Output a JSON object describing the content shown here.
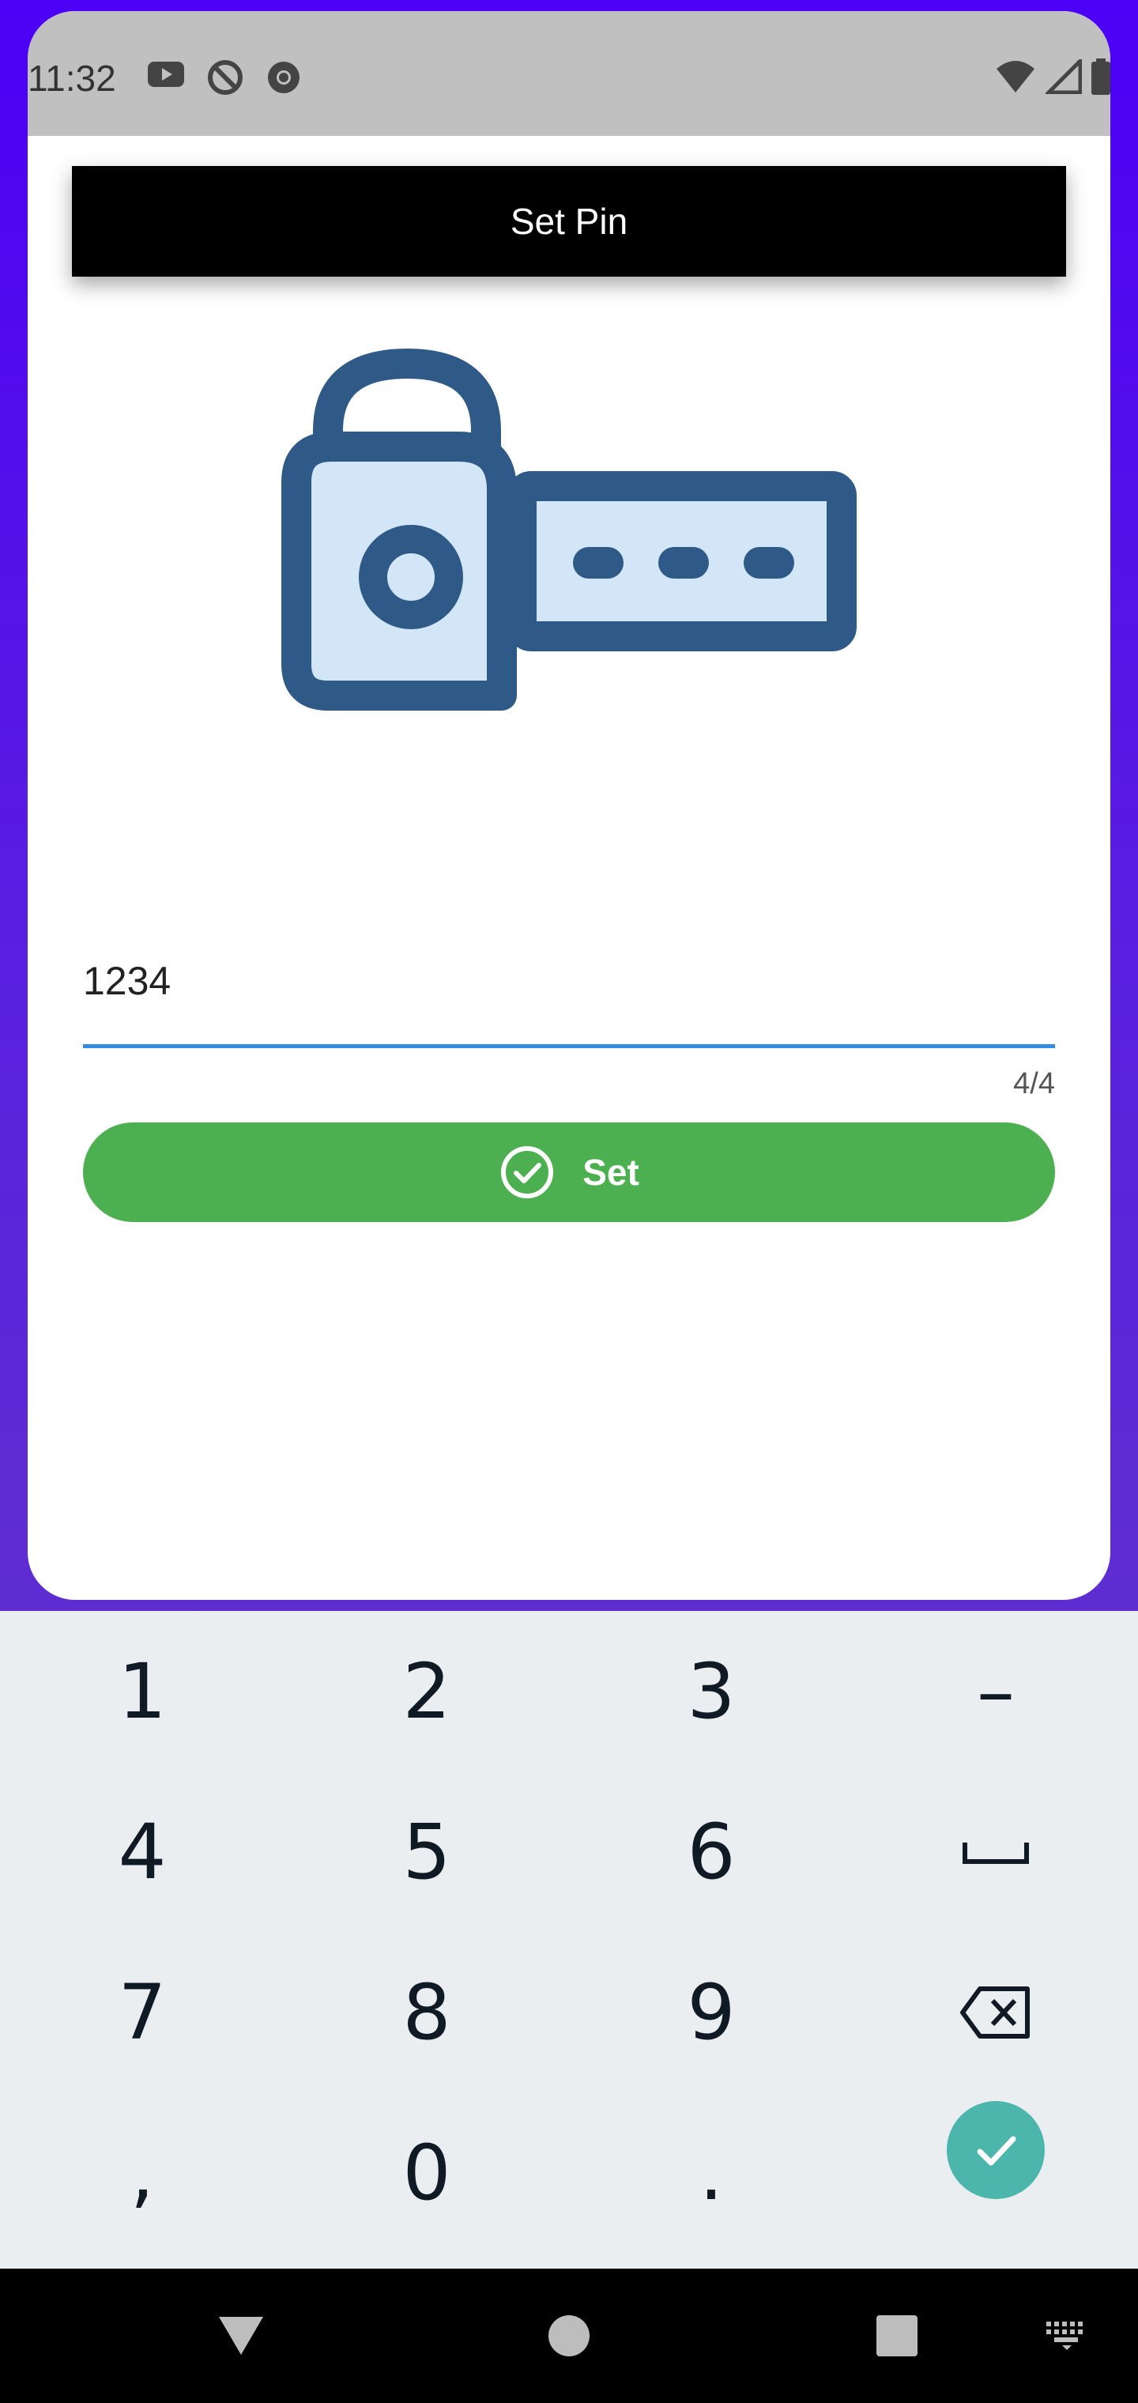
{
  "status_bar": {
    "time": "11:32",
    "left_icons": [
      "youtube-icon",
      "blocked-icon",
      "chrome-icon"
    ],
    "right_icons": [
      "wifi-icon",
      "cell-signal-icon",
      "battery-icon"
    ]
  },
  "header": {
    "title": "Set Pin"
  },
  "pin_input": {
    "value": "1234",
    "counter": "4/4"
  },
  "set_button": {
    "label": "Set",
    "icon": "check-circle-icon"
  },
  "keyboard": {
    "keys": [
      [
        "1",
        "2",
        "3",
        "–"
      ],
      [
        "4",
        "5",
        "6",
        "␣"
      ],
      [
        "7",
        "8",
        "9",
        "⌫"
      ],
      [
        ",",
        "0",
        ".",
        "✓"
      ]
    ]
  },
  "nav_bar": {
    "icons": [
      "back-icon",
      "home-icon",
      "recents-icon",
      "keyboard-icon"
    ]
  },
  "colors": {
    "accent_blue": "#2e8fe0",
    "button_green": "#4caf50",
    "keyboard_ok": "#4db6ac",
    "illustration_dark": "#2f5a87",
    "illustration_light": "#d3e6f8"
  }
}
